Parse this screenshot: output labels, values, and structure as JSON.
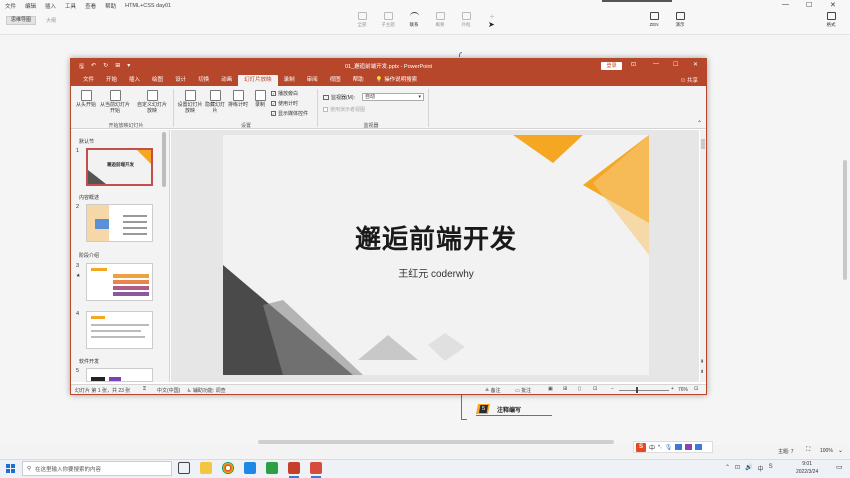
{
  "menu": [
    "文件",
    "编辑",
    "插入",
    "工具",
    "查看",
    "帮助",
    "HTML+CSS day01"
  ],
  "outer_tab": "思维导图",
  "outer_tab2": "大纲",
  "toolbar": [
    {
      "label": "全部",
      "active": false
    },
    {
      "label": "子主题",
      "active": false
    },
    {
      "label": "联系",
      "active": true
    },
    {
      "label": "概要",
      "active": false
    },
    {
      "label": "外框",
      "active": false
    },
    {
      "label": "",
      "active": false
    }
  ],
  "toolbar_right": [
    {
      "label": "ZEN"
    },
    {
      "label": "演示"
    }
  ],
  "toolbar_far_right": "格式",
  "ppt": {
    "title": "01_邂逅前端开发.pptx - PowerPoint",
    "login": "登录",
    "share": "共享",
    "tabs": [
      "文件",
      "开始",
      "插入",
      "绘图",
      "设计",
      "切换",
      "动画",
      "幻灯片放映",
      "录制",
      "审阅",
      "视图",
      "帮助",
      "操作说明搜索"
    ],
    "active_tab": "幻灯片放映",
    "ribbon": {
      "from_start": "从头开始",
      "from_current": "从当前幻灯片开始",
      "custom": "自定义幻灯片放映",
      "group1": "开始放映幻灯片",
      "setup": "设置幻灯片放映",
      "hide": "隐藏幻灯片",
      "rehearse": "排练计时",
      "record": "录制",
      "group2": "设置",
      "chk_narration": "播放旁白",
      "chk_timings": "使用计时",
      "chk_media": "显示媒体控件",
      "monitor_label": "监视器(M):",
      "monitor_value": "自动",
      "presenter": "使用演示者视图",
      "group3": "监视器"
    },
    "sections": [
      {
        "label": "默认节"
      },
      {
        "label": "内容概述"
      },
      {
        "label": "阶段介绍"
      },
      {
        "label": "软件开发"
      }
    ],
    "thumb_nums": [
      "1",
      "2",
      "3",
      "4",
      "5"
    ],
    "thumb1_title": "邂逅前端开发",
    "slide": {
      "title": "邂逅前端开发",
      "subtitle": "王红元 coderwhy"
    },
    "status": {
      "slide_info": "幻灯片 第 1 张，共 23 张",
      "lang": "中文(中国)",
      "accessibility": "辅助功能: 调查",
      "notes": "备注",
      "comments": "批注",
      "zoom": "76%"
    },
    "colors": {
      "accent": "#b7472a",
      "orange": "#f5a623"
    }
  },
  "mindmap_node": {
    "badge": "5",
    "label": "注释编写"
  },
  "status_bar": {
    "theme": "主题: 7",
    "zoom": "100%"
  },
  "taskbar": {
    "search_placeholder": "在这里输入你要搜索的内容",
    "time": "9:01",
    "date": "2022/3/24"
  }
}
